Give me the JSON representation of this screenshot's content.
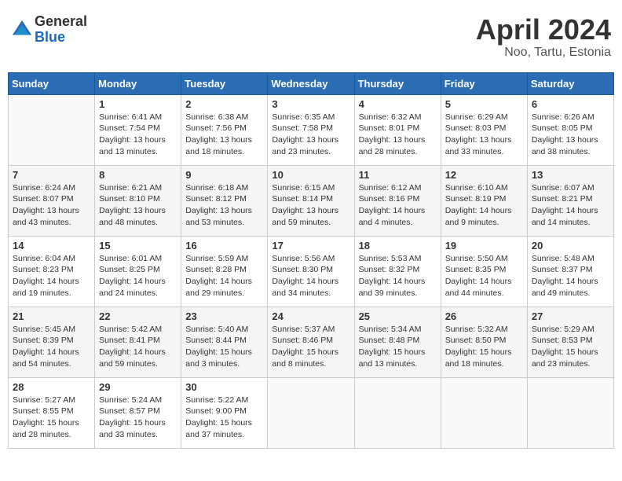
{
  "header": {
    "logo_general": "General",
    "logo_blue": "Blue",
    "month_title": "April 2024",
    "location": "Noo, Tartu, Estonia"
  },
  "days_of_week": [
    "Sunday",
    "Monday",
    "Tuesday",
    "Wednesday",
    "Thursday",
    "Friday",
    "Saturday"
  ],
  "weeks": [
    [
      {
        "day": "",
        "sunrise": "",
        "sunset": "",
        "daylight": ""
      },
      {
        "day": "1",
        "sunrise": "Sunrise: 6:41 AM",
        "sunset": "Sunset: 7:54 PM",
        "daylight": "Daylight: 13 hours and 13 minutes."
      },
      {
        "day": "2",
        "sunrise": "Sunrise: 6:38 AM",
        "sunset": "Sunset: 7:56 PM",
        "daylight": "Daylight: 13 hours and 18 minutes."
      },
      {
        "day": "3",
        "sunrise": "Sunrise: 6:35 AM",
        "sunset": "Sunset: 7:58 PM",
        "daylight": "Daylight: 13 hours and 23 minutes."
      },
      {
        "day": "4",
        "sunrise": "Sunrise: 6:32 AM",
        "sunset": "Sunset: 8:01 PM",
        "daylight": "Daylight: 13 hours and 28 minutes."
      },
      {
        "day": "5",
        "sunrise": "Sunrise: 6:29 AM",
        "sunset": "Sunset: 8:03 PM",
        "daylight": "Daylight: 13 hours and 33 minutes."
      },
      {
        "day": "6",
        "sunrise": "Sunrise: 6:26 AM",
        "sunset": "Sunset: 8:05 PM",
        "daylight": "Daylight: 13 hours and 38 minutes."
      }
    ],
    [
      {
        "day": "7",
        "sunrise": "Sunrise: 6:24 AM",
        "sunset": "Sunset: 8:07 PM",
        "daylight": "Daylight: 13 hours and 43 minutes."
      },
      {
        "day": "8",
        "sunrise": "Sunrise: 6:21 AM",
        "sunset": "Sunset: 8:10 PM",
        "daylight": "Daylight: 13 hours and 48 minutes."
      },
      {
        "day": "9",
        "sunrise": "Sunrise: 6:18 AM",
        "sunset": "Sunset: 8:12 PM",
        "daylight": "Daylight: 13 hours and 53 minutes."
      },
      {
        "day": "10",
        "sunrise": "Sunrise: 6:15 AM",
        "sunset": "Sunset: 8:14 PM",
        "daylight": "Daylight: 13 hours and 59 minutes."
      },
      {
        "day": "11",
        "sunrise": "Sunrise: 6:12 AM",
        "sunset": "Sunset: 8:16 PM",
        "daylight": "Daylight: 14 hours and 4 minutes."
      },
      {
        "day": "12",
        "sunrise": "Sunrise: 6:10 AM",
        "sunset": "Sunset: 8:19 PM",
        "daylight": "Daylight: 14 hours and 9 minutes."
      },
      {
        "day": "13",
        "sunrise": "Sunrise: 6:07 AM",
        "sunset": "Sunset: 8:21 PM",
        "daylight": "Daylight: 14 hours and 14 minutes."
      }
    ],
    [
      {
        "day": "14",
        "sunrise": "Sunrise: 6:04 AM",
        "sunset": "Sunset: 8:23 PM",
        "daylight": "Daylight: 14 hours and 19 minutes."
      },
      {
        "day": "15",
        "sunrise": "Sunrise: 6:01 AM",
        "sunset": "Sunset: 8:25 PM",
        "daylight": "Daylight: 14 hours and 24 minutes."
      },
      {
        "day": "16",
        "sunrise": "Sunrise: 5:59 AM",
        "sunset": "Sunset: 8:28 PM",
        "daylight": "Daylight: 14 hours and 29 minutes."
      },
      {
        "day": "17",
        "sunrise": "Sunrise: 5:56 AM",
        "sunset": "Sunset: 8:30 PM",
        "daylight": "Daylight: 14 hours and 34 minutes."
      },
      {
        "day": "18",
        "sunrise": "Sunrise: 5:53 AM",
        "sunset": "Sunset: 8:32 PM",
        "daylight": "Daylight: 14 hours and 39 minutes."
      },
      {
        "day": "19",
        "sunrise": "Sunrise: 5:50 AM",
        "sunset": "Sunset: 8:35 PM",
        "daylight": "Daylight: 14 hours and 44 minutes."
      },
      {
        "day": "20",
        "sunrise": "Sunrise: 5:48 AM",
        "sunset": "Sunset: 8:37 PM",
        "daylight": "Daylight: 14 hours and 49 minutes."
      }
    ],
    [
      {
        "day": "21",
        "sunrise": "Sunrise: 5:45 AM",
        "sunset": "Sunset: 8:39 PM",
        "daylight": "Daylight: 14 hours and 54 minutes."
      },
      {
        "day": "22",
        "sunrise": "Sunrise: 5:42 AM",
        "sunset": "Sunset: 8:41 PM",
        "daylight": "Daylight: 14 hours and 59 minutes."
      },
      {
        "day": "23",
        "sunrise": "Sunrise: 5:40 AM",
        "sunset": "Sunset: 8:44 PM",
        "daylight": "Daylight: 15 hours and 3 minutes."
      },
      {
        "day": "24",
        "sunrise": "Sunrise: 5:37 AM",
        "sunset": "Sunset: 8:46 PM",
        "daylight": "Daylight: 15 hours and 8 minutes."
      },
      {
        "day": "25",
        "sunrise": "Sunrise: 5:34 AM",
        "sunset": "Sunset: 8:48 PM",
        "daylight": "Daylight: 15 hours and 13 minutes."
      },
      {
        "day": "26",
        "sunrise": "Sunrise: 5:32 AM",
        "sunset": "Sunset: 8:50 PM",
        "daylight": "Daylight: 15 hours and 18 minutes."
      },
      {
        "day": "27",
        "sunrise": "Sunrise: 5:29 AM",
        "sunset": "Sunset: 8:53 PM",
        "daylight": "Daylight: 15 hours and 23 minutes."
      }
    ],
    [
      {
        "day": "28",
        "sunrise": "Sunrise: 5:27 AM",
        "sunset": "Sunset: 8:55 PM",
        "daylight": "Daylight: 15 hours and 28 minutes."
      },
      {
        "day": "29",
        "sunrise": "Sunrise: 5:24 AM",
        "sunset": "Sunset: 8:57 PM",
        "daylight": "Daylight: 15 hours and 33 minutes."
      },
      {
        "day": "30",
        "sunrise": "Sunrise: 5:22 AM",
        "sunset": "Sunset: 9:00 PM",
        "daylight": "Daylight: 15 hours and 37 minutes."
      },
      {
        "day": "",
        "sunrise": "",
        "sunset": "",
        "daylight": ""
      },
      {
        "day": "",
        "sunrise": "",
        "sunset": "",
        "daylight": ""
      },
      {
        "day": "",
        "sunrise": "",
        "sunset": "",
        "daylight": ""
      },
      {
        "day": "",
        "sunrise": "",
        "sunset": "",
        "daylight": ""
      }
    ]
  ]
}
